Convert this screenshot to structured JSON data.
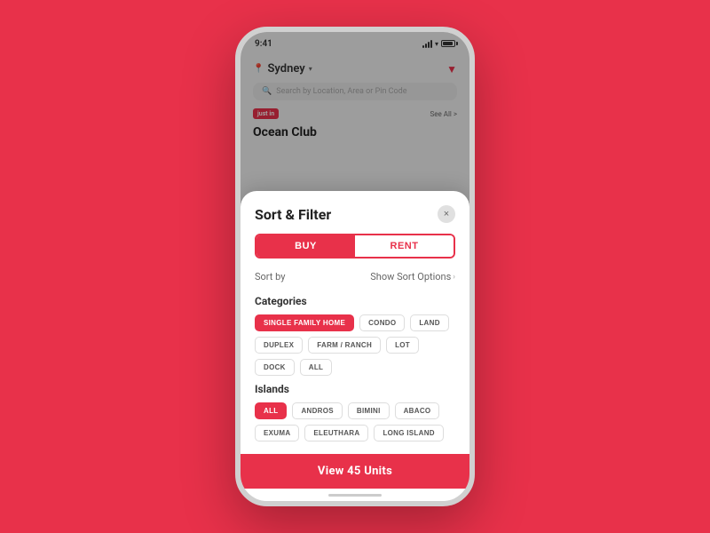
{
  "phone": {
    "status_time": "9:41",
    "location": "Sydney",
    "search_placeholder": "Search by Location, Area or Pin Code",
    "just_in_label": "just in",
    "see_all_label": "See All >",
    "property_name": "Ocean Club"
  },
  "modal": {
    "title": "Sort & Filter",
    "close_label": "×",
    "buy_label": "BUY",
    "rent_label": "RENT",
    "sort_label": "Sort by",
    "sort_options_label": "Show Sort Options",
    "sort_chevron": "›",
    "categories_title": "Categories",
    "categories": [
      {
        "label": "SINGLE FAMILY HOME",
        "active": true
      },
      {
        "label": "CONDO",
        "active": false
      },
      {
        "label": "LAND",
        "active": false
      },
      {
        "label": "DUPLEX",
        "active": false
      },
      {
        "label": "FARM / RANCH",
        "active": false
      },
      {
        "label": "LOT",
        "active": false
      },
      {
        "label": "DOCK",
        "active": false
      },
      {
        "label": "ALL",
        "active": false
      }
    ],
    "islands_title": "Islands",
    "islands": [
      {
        "label": "ALL",
        "active": true
      },
      {
        "label": "ANDROS",
        "active": false
      },
      {
        "label": "BIMINI",
        "active": false
      },
      {
        "label": "ABACO",
        "active": false
      },
      {
        "label": "EXUMA",
        "active": false
      },
      {
        "label": "ELEUTHARA",
        "active": false
      },
      {
        "label": "LONG ISLAND",
        "active": false
      }
    ],
    "view_btn_label": "View 45 Units"
  },
  "colors": {
    "brand_red": "#e8314a",
    "bg_red": "#e8314a"
  }
}
